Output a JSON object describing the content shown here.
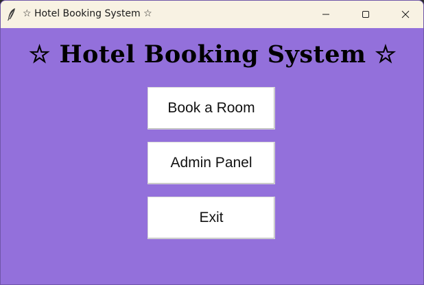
{
  "window": {
    "title": "☆ Hotel Booking System ☆",
    "icon": "feather-icon",
    "controls": {
      "minimize_icon": "minimize-icon",
      "maximize_icon": "maximize-icon",
      "close_icon": "close-icon"
    }
  },
  "main": {
    "heading": "☆ Hotel Booking System ☆",
    "buttons": [
      {
        "label": "Book a Room"
      },
      {
        "label": "Admin Panel"
      },
      {
        "label": "Exit"
      }
    ]
  },
  "colors": {
    "background": "#9370db",
    "titlebar": "#f8f2e3",
    "button": "#ffffff"
  }
}
